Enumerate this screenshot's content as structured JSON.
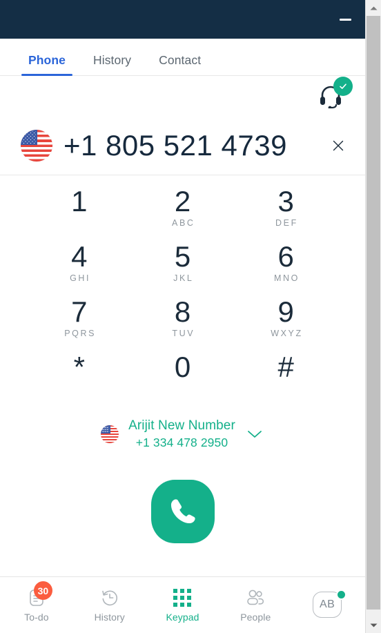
{
  "window": {
    "titlebar_color": "#142e45",
    "minimize_label": "—"
  },
  "tabs": [
    {
      "label": "Phone",
      "active": true,
      "name": "tab-phone"
    },
    {
      "label": "History",
      "active": false,
      "name": "tab-history"
    },
    {
      "label": "Contact",
      "active": false,
      "name": "tab-contact"
    }
  ],
  "status": {
    "headset_icon": "headset-icon",
    "connected_check": "check-icon",
    "accent_green": "#14b08a"
  },
  "dialer": {
    "country_flag": "us-flag-icon",
    "number": "+1 805 521 4739",
    "clear_label": "×"
  },
  "keypad": {
    "keys": [
      {
        "digit": "1",
        "letters": ""
      },
      {
        "digit": "2",
        "letters": "ABC"
      },
      {
        "digit": "3",
        "letters": "DEF"
      },
      {
        "digit": "4",
        "letters": "GHI"
      },
      {
        "digit": "5",
        "letters": "JKL"
      },
      {
        "digit": "6",
        "letters": "MNO"
      },
      {
        "digit": "7",
        "letters": "PQRS"
      },
      {
        "digit": "8",
        "letters": "TUV"
      },
      {
        "digit": "9",
        "letters": "WXYZ"
      },
      {
        "digit": "*",
        "letters": ""
      },
      {
        "digit": "0",
        "letters": ""
      },
      {
        "digit": "#",
        "letters": ""
      }
    ]
  },
  "caller_id": {
    "flag": "us-flag-icon",
    "name": "Arijit New Number",
    "number": "+1 334 478 2950",
    "dropdown_icon": "chevron-down-icon",
    "color": "#14b08a"
  },
  "call_button": {
    "icon": "phone-handset-icon",
    "color": "#14b08a"
  },
  "bottom_nav": [
    {
      "label": "To-do",
      "icon": "todo-icon",
      "badge": "30",
      "active": false
    },
    {
      "label": "History",
      "icon": "history-icon",
      "badge": "",
      "active": false
    },
    {
      "label": "Keypad",
      "icon": "keypad-icon",
      "badge": "",
      "active": true
    },
    {
      "label": "People",
      "icon": "people-icon",
      "badge": "",
      "active": false
    },
    {
      "label": "",
      "icon": "avatar-icon",
      "badge": "",
      "active": false,
      "initials": "AB"
    }
  ]
}
